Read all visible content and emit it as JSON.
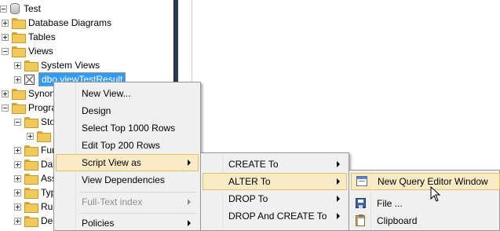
{
  "tree": {
    "items": [
      {
        "label": "Test"
      },
      {
        "label": "Database Diagrams"
      },
      {
        "label": "Tables"
      },
      {
        "label": "Views"
      },
      {
        "label": "System Views"
      },
      {
        "label": "dbo.viewTestResult"
      },
      {
        "label": "Synony"
      },
      {
        "label": "Progra"
      },
      {
        "label": "Sto"
      },
      {
        "label": ""
      },
      {
        "label": "Fun"
      },
      {
        "label": "Dat"
      },
      {
        "label": "Ass"
      },
      {
        "label": "Typ"
      },
      {
        "label": "Ru"
      },
      {
        "label": "De"
      }
    ]
  },
  "context_menu": {
    "items": [
      {
        "label": "New View..."
      },
      {
        "label": "Design"
      },
      {
        "label": "Select Top 1000 Rows"
      },
      {
        "label": "Edit Top 200 Rows"
      },
      {
        "label": "Script View as"
      },
      {
        "label": "View Dependencies"
      },
      {
        "label": "Full-Text index"
      },
      {
        "label": "Policies"
      }
    ]
  },
  "script_submenu": {
    "items": [
      {
        "label": "CREATE To"
      },
      {
        "label": "ALTER To"
      },
      {
        "label": "DROP To"
      },
      {
        "label": "DROP And CREATE To"
      }
    ]
  },
  "alter_submenu": {
    "items": [
      {
        "label": "New Query Editor Window"
      },
      {
        "label": "File ..."
      },
      {
        "label": "Clipboard"
      }
    ]
  },
  "colors": {
    "selection": "#3399ff",
    "menu_highlight": "#fbeac6",
    "menu_highlight_border": "#e5c365",
    "splitter": "#2b3a55"
  },
  "icons": {
    "tree_folder": "folder-icon",
    "tree_database": "database-icon",
    "tree_view": "view-icon",
    "new_query": "query-window-icon",
    "file": "save-icon",
    "clipboard": "clipboard-icon",
    "pointer": "mouse-pointer-icon"
  }
}
